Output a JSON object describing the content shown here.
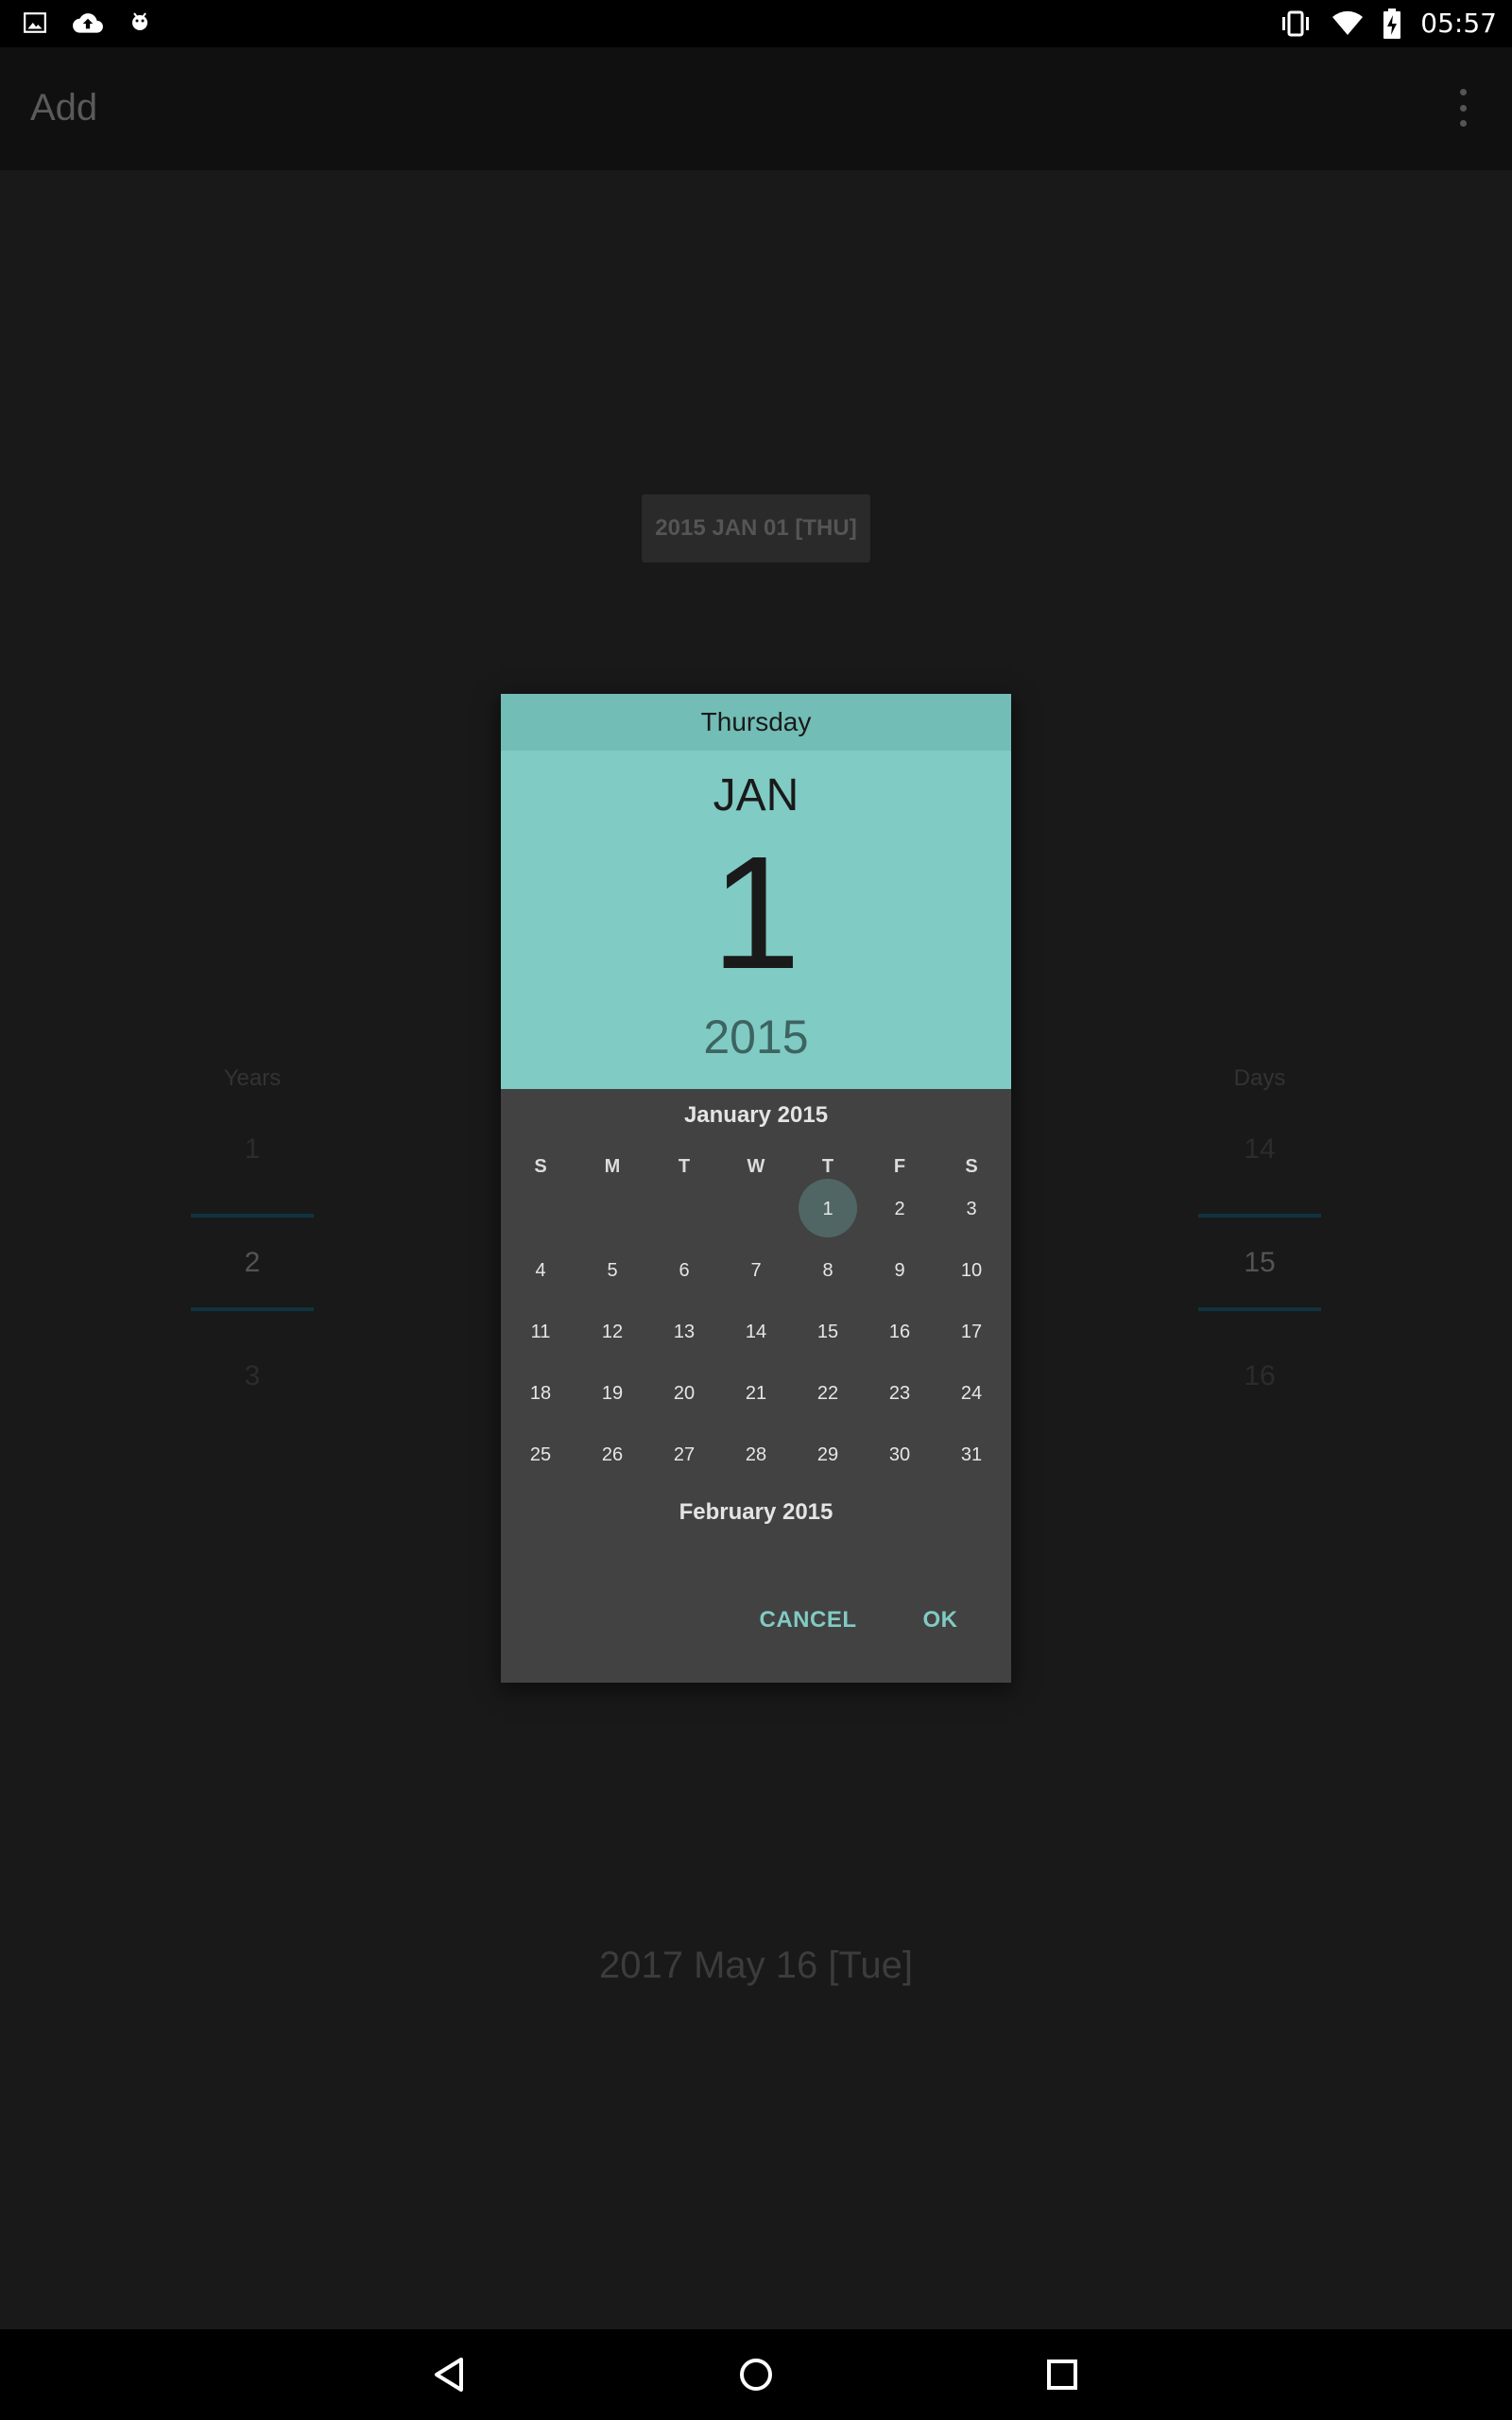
{
  "status_bar": {
    "time": "05:57",
    "left_icons": [
      "image-icon",
      "cloud-upload-icon",
      "android-icon"
    ],
    "right_icons": [
      "vibrate-icon",
      "wifi-icon",
      "battery-charging-icon"
    ]
  },
  "app_bar": {
    "title": "Add",
    "overflow_icon": "more-vert-icon"
  },
  "background": {
    "date_chip": "2015 JAN 01 [THU]",
    "years": {
      "label": "Years",
      "values": [
        "1",
        "2",
        "3"
      ]
    },
    "days": {
      "label": "Days",
      "values": [
        "14",
        "15",
        "16"
      ]
    },
    "bottom_date": "2017 May 16 [Tue]"
  },
  "dialog": {
    "weekday": "Thursday",
    "month": "JAN",
    "day": "1",
    "year": "2015",
    "calendar_title": "January 2015",
    "weekday_headers": [
      "S",
      "M",
      "T",
      "W",
      "T",
      "F",
      "S"
    ],
    "weeks": [
      [
        "",
        "",
        "",
        "",
        "1",
        "2",
        "3"
      ],
      [
        "4",
        "5",
        "6",
        "7",
        "8",
        "9",
        "10"
      ],
      [
        "11",
        "12",
        "13",
        "14",
        "15",
        "16",
        "17"
      ],
      [
        "18",
        "19",
        "20",
        "21",
        "22",
        "23",
        "24"
      ],
      [
        "25",
        "26",
        "27",
        "28",
        "29",
        "30",
        "31"
      ]
    ],
    "selected_day": "1",
    "next_month_title": "February 2015",
    "cancel_label": "CANCEL",
    "ok_label": "OK",
    "accent_color": "#80cbc4"
  },
  "nav_bar": {
    "icons": [
      "back-icon",
      "home-icon",
      "recents-icon"
    ]
  }
}
